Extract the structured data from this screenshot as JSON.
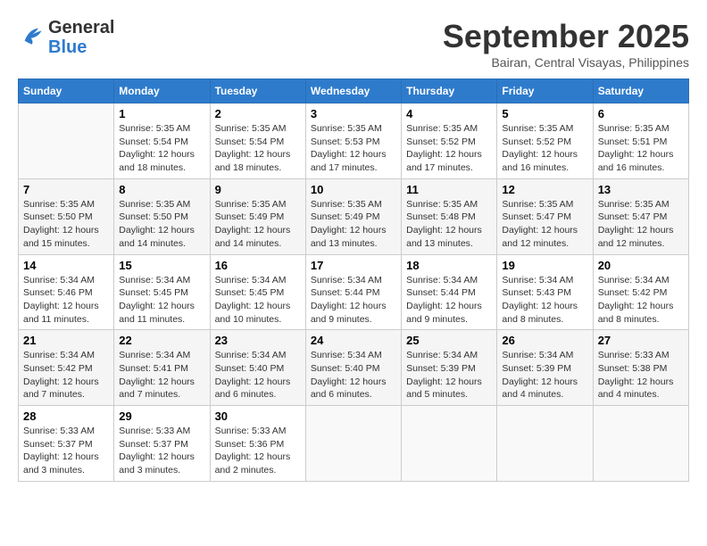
{
  "header": {
    "logo_line1": "General",
    "logo_line2": "Blue",
    "month_title": "September 2025",
    "location": "Bairan, Central Visayas, Philippines"
  },
  "days_of_week": [
    "Sunday",
    "Monday",
    "Tuesday",
    "Wednesday",
    "Thursday",
    "Friday",
    "Saturday"
  ],
  "weeks": [
    [
      {
        "day": "",
        "info": ""
      },
      {
        "day": "1",
        "info": "Sunrise: 5:35 AM\nSunset: 5:54 PM\nDaylight: 12 hours\nand 18 minutes."
      },
      {
        "day": "2",
        "info": "Sunrise: 5:35 AM\nSunset: 5:54 PM\nDaylight: 12 hours\nand 18 minutes."
      },
      {
        "day": "3",
        "info": "Sunrise: 5:35 AM\nSunset: 5:53 PM\nDaylight: 12 hours\nand 17 minutes."
      },
      {
        "day": "4",
        "info": "Sunrise: 5:35 AM\nSunset: 5:52 PM\nDaylight: 12 hours\nand 17 minutes."
      },
      {
        "day": "5",
        "info": "Sunrise: 5:35 AM\nSunset: 5:52 PM\nDaylight: 12 hours\nand 16 minutes."
      },
      {
        "day": "6",
        "info": "Sunrise: 5:35 AM\nSunset: 5:51 PM\nDaylight: 12 hours\nand 16 minutes."
      }
    ],
    [
      {
        "day": "7",
        "info": "Sunrise: 5:35 AM\nSunset: 5:50 PM\nDaylight: 12 hours\nand 15 minutes."
      },
      {
        "day": "8",
        "info": "Sunrise: 5:35 AM\nSunset: 5:50 PM\nDaylight: 12 hours\nand 14 minutes."
      },
      {
        "day": "9",
        "info": "Sunrise: 5:35 AM\nSunset: 5:49 PM\nDaylight: 12 hours\nand 14 minutes."
      },
      {
        "day": "10",
        "info": "Sunrise: 5:35 AM\nSunset: 5:49 PM\nDaylight: 12 hours\nand 13 minutes."
      },
      {
        "day": "11",
        "info": "Sunrise: 5:35 AM\nSunset: 5:48 PM\nDaylight: 12 hours\nand 13 minutes."
      },
      {
        "day": "12",
        "info": "Sunrise: 5:35 AM\nSunset: 5:47 PM\nDaylight: 12 hours\nand 12 minutes."
      },
      {
        "day": "13",
        "info": "Sunrise: 5:35 AM\nSunset: 5:47 PM\nDaylight: 12 hours\nand 12 minutes."
      }
    ],
    [
      {
        "day": "14",
        "info": "Sunrise: 5:34 AM\nSunset: 5:46 PM\nDaylight: 12 hours\nand 11 minutes."
      },
      {
        "day": "15",
        "info": "Sunrise: 5:34 AM\nSunset: 5:45 PM\nDaylight: 12 hours\nand 11 minutes."
      },
      {
        "day": "16",
        "info": "Sunrise: 5:34 AM\nSunset: 5:45 PM\nDaylight: 12 hours\nand 10 minutes."
      },
      {
        "day": "17",
        "info": "Sunrise: 5:34 AM\nSunset: 5:44 PM\nDaylight: 12 hours\nand 9 minutes."
      },
      {
        "day": "18",
        "info": "Sunrise: 5:34 AM\nSunset: 5:44 PM\nDaylight: 12 hours\nand 9 minutes."
      },
      {
        "day": "19",
        "info": "Sunrise: 5:34 AM\nSunset: 5:43 PM\nDaylight: 12 hours\nand 8 minutes."
      },
      {
        "day": "20",
        "info": "Sunrise: 5:34 AM\nSunset: 5:42 PM\nDaylight: 12 hours\nand 8 minutes."
      }
    ],
    [
      {
        "day": "21",
        "info": "Sunrise: 5:34 AM\nSunset: 5:42 PM\nDaylight: 12 hours\nand 7 minutes."
      },
      {
        "day": "22",
        "info": "Sunrise: 5:34 AM\nSunset: 5:41 PM\nDaylight: 12 hours\nand 7 minutes."
      },
      {
        "day": "23",
        "info": "Sunrise: 5:34 AM\nSunset: 5:40 PM\nDaylight: 12 hours\nand 6 minutes."
      },
      {
        "day": "24",
        "info": "Sunrise: 5:34 AM\nSunset: 5:40 PM\nDaylight: 12 hours\nand 6 minutes."
      },
      {
        "day": "25",
        "info": "Sunrise: 5:34 AM\nSunset: 5:39 PM\nDaylight: 12 hours\nand 5 minutes."
      },
      {
        "day": "26",
        "info": "Sunrise: 5:34 AM\nSunset: 5:39 PM\nDaylight: 12 hours\nand 4 minutes."
      },
      {
        "day": "27",
        "info": "Sunrise: 5:33 AM\nSunset: 5:38 PM\nDaylight: 12 hours\nand 4 minutes."
      }
    ],
    [
      {
        "day": "28",
        "info": "Sunrise: 5:33 AM\nSunset: 5:37 PM\nDaylight: 12 hours\nand 3 minutes."
      },
      {
        "day": "29",
        "info": "Sunrise: 5:33 AM\nSunset: 5:37 PM\nDaylight: 12 hours\nand 3 minutes."
      },
      {
        "day": "30",
        "info": "Sunrise: 5:33 AM\nSunset: 5:36 PM\nDaylight: 12 hours\nand 2 minutes."
      },
      {
        "day": "",
        "info": ""
      },
      {
        "day": "",
        "info": ""
      },
      {
        "day": "",
        "info": ""
      },
      {
        "day": "",
        "info": ""
      }
    ]
  ]
}
